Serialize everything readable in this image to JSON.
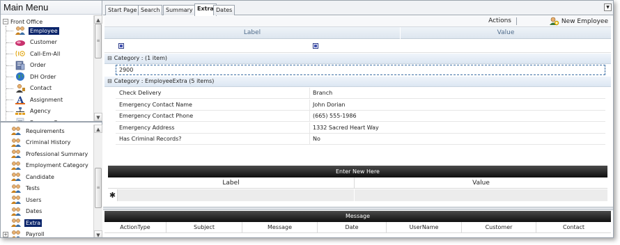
{
  "left_panel": {
    "title": "Main Menu",
    "tree": {
      "root_expander": "−",
      "root_label": "Front Office",
      "items": [
        {
          "label": "Employee",
          "icon": "people-icon",
          "selected": true
        },
        {
          "label": "Customer",
          "icon": "customer-icon",
          "selected": false
        },
        {
          "label": "Call-Em-All",
          "icon": "phone-call-icon",
          "selected": false
        },
        {
          "label": "Order",
          "icon": "order-icon",
          "selected": false
        },
        {
          "label": "DH Order",
          "icon": "globe-icon",
          "selected": false
        },
        {
          "label": "Contact",
          "icon": "contact-icon",
          "selected": false
        },
        {
          "label": "Assignment",
          "icon": "assignment-icon",
          "selected": false
        },
        {
          "label": "Agency",
          "icon": "agency-icon",
          "selected": false
        },
        {
          "label": "Resume Parser",
          "icon": "resume-icon",
          "selected": false
        }
      ]
    },
    "list": {
      "items": [
        {
          "label": "Requirements",
          "selected": false
        },
        {
          "label": "Criminal History",
          "selected": false
        },
        {
          "label": "Professional Summary",
          "selected": false
        },
        {
          "label": "Employment Category",
          "selected": false
        },
        {
          "label": "Candidate",
          "selected": false
        },
        {
          "label": "Tests",
          "selected": false
        },
        {
          "label": "Users",
          "selected": false
        },
        {
          "label": "Dates",
          "selected": false
        },
        {
          "label": "Extra",
          "selected": true
        },
        {
          "label": "Payroll",
          "selected": false
        }
      ],
      "payroll_expander": "+"
    }
  },
  "tabs": {
    "items": [
      "Start Page",
      "Search",
      "Summary",
      "Extra",
      "Dates"
    ],
    "active": "Extra",
    "dropdown_glyph": "▼"
  },
  "toolbar": {
    "actions_label": "Actions",
    "new_employee_label": "New Employee"
  },
  "grid": {
    "col_label": "Label",
    "col_value": "Value",
    "groups": [
      {
        "header": "Category : (1 item)",
        "expander": "⊟",
        "edit_value": "2900"
      },
      {
        "header": "Category : EmployeeExtra (5 items)",
        "expander": "⊟",
        "rows": [
          {
            "label": "Check Delivery",
            "value": "Branch"
          },
          {
            "label": "Emergency Contact Name",
            "value": "John Dorian"
          },
          {
            "label": "Emergency Contact Phone",
            "value": "(665) 555-1986"
          },
          {
            "label": "Emergency Address",
            "value": "1332 Sacred Heart Way"
          },
          {
            "label": "Has Criminal Records?",
            "value": "No"
          }
        ]
      }
    ]
  },
  "new_entry": {
    "title": "Enter New Here",
    "col_label": "Label",
    "col_value": "Value",
    "new_row_marker": "✱"
  },
  "messages": {
    "title": "Message",
    "columns": [
      "ActionType",
      "Subject",
      "Message",
      "Date",
      "UserName",
      "Customer",
      "Contact"
    ]
  },
  "colors": {
    "selection": "#0a246a",
    "header_blue": "#4f6b8a",
    "dark_bar": "#1a1a1a"
  }
}
